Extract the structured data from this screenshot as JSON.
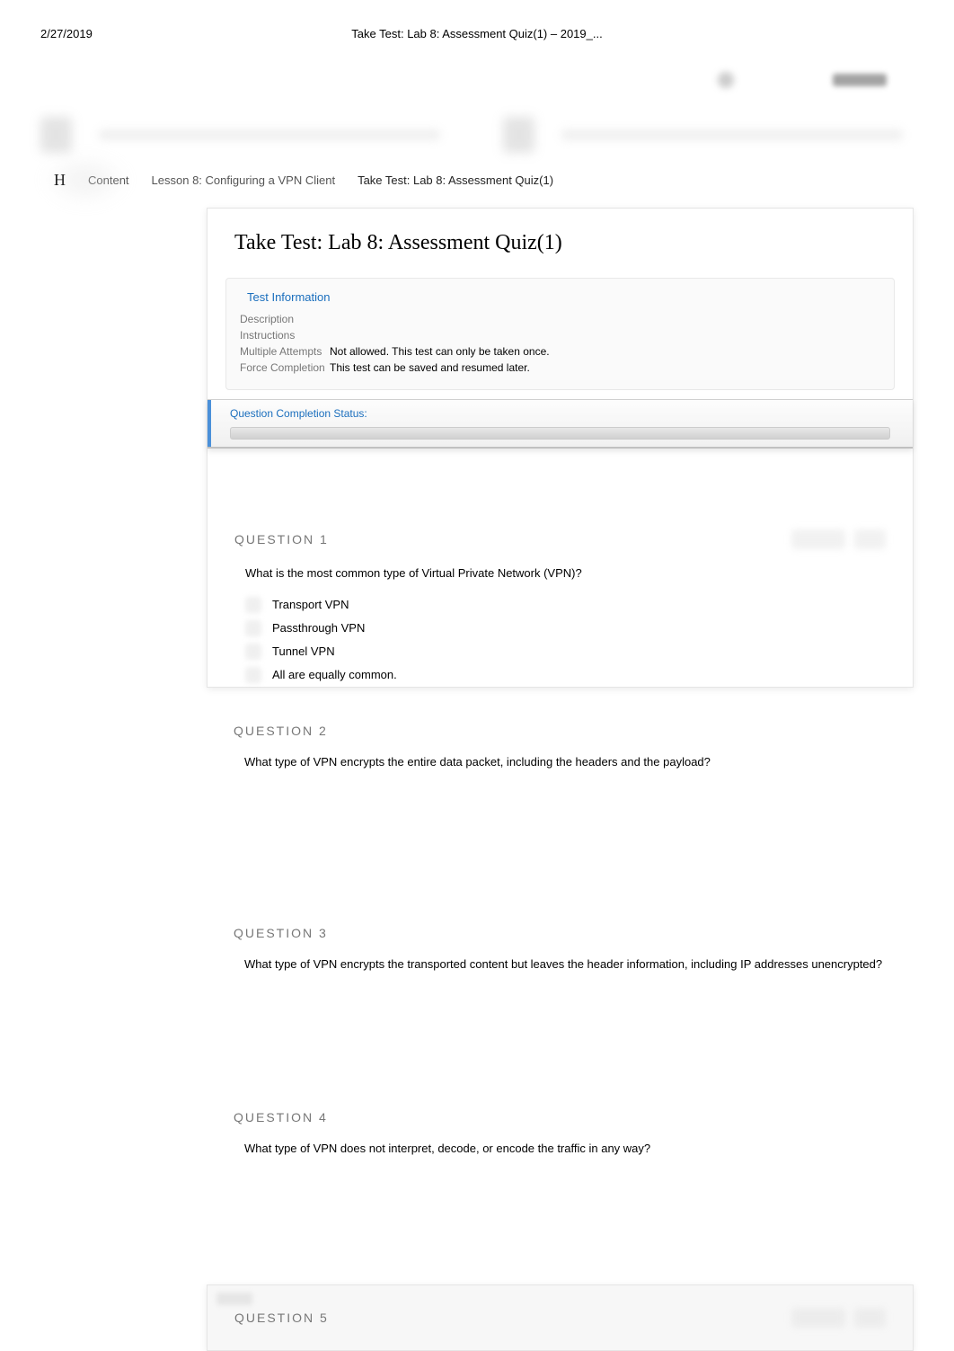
{
  "print": {
    "date": "2/27/2019",
    "title": "Take Test: Lab 8: Assessment Quiz(1) – 2019_..."
  },
  "breadcrumb": {
    "home": "H",
    "content": "Content",
    "lesson": "Lesson 8: Configuring a VPN Client",
    "current": "Take Test: Lab 8: Assessment Quiz(1)"
  },
  "page_title": "Take Test: Lab 8: Assessment Quiz(1)",
  "test_info": {
    "heading": "Test Information",
    "rows": {
      "description_label": "Description",
      "description_value": "",
      "instructions_label": "Instructions",
      "instructions_value": "",
      "attempts_label": "Multiple Attempts",
      "attempts_value": "Not allowed. This test can only be taken once.",
      "completion_label": "Force Completion",
      "completion_value": "This test can be saved and resumed later."
    }
  },
  "status": {
    "label": "Question Completion Status:"
  },
  "questions": [
    {
      "label": "QUESTION 1",
      "text": "What is the most common type of Virtual Private Network (VPN)?",
      "answers": [
        "Transport VPN",
        "Passthrough VPN",
        "Tunnel VPN",
        "All are equally common."
      ]
    },
    {
      "label": "QUESTION 2",
      "text": "What type of VPN encrypts the entire data packet, including the headers and the payload?",
      "answers": []
    },
    {
      "label": "QUESTION 3",
      "text": "What type of VPN encrypts the transported content but leaves the header information, including IP addresses unencrypted?",
      "answers": []
    },
    {
      "label": "QUESTION 4",
      "text": "What type of VPN does not interpret, decode, or encode the traffic in any way?",
      "answers": []
    },
    {
      "label": "QUESTION 5",
      "text": "",
      "answers": []
    }
  ]
}
